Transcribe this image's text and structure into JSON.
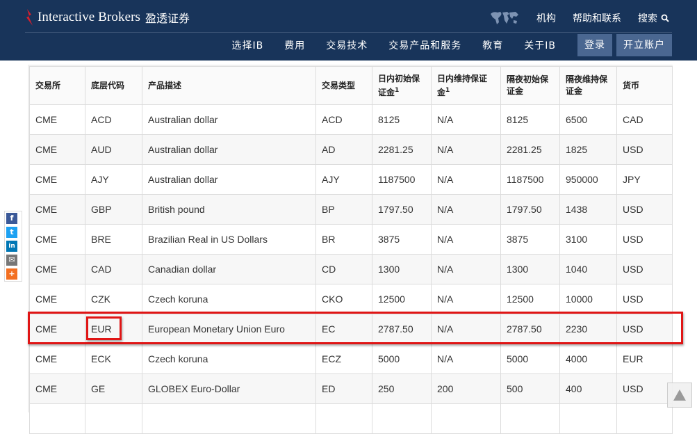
{
  "header": {
    "logo_en": "Interactive Brokers",
    "logo_cn": "盈透证券",
    "util": {
      "institutions": "机构",
      "help": "帮助和联系",
      "search": "搜索"
    },
    "nav": [
      "选择IB",
      "费用",
      "交易技术",
      "交易产品和服务",
      "教育",
      "关于IB"
    ],
    "login": "登录",
    "open_account": "开立账户"
  },
  "table": {
    "headers": [
      {
        "text": "交易所",
        "sup": ""
      },
      {
        "text": "底层代码",
        "sup": ""
      },
      {
        "text": "产品描述",
        "sup": ""
      },
      {
        "text": "交易类型",
        "sup": ""
      },
      {
        "text": "日内初始保证金",
        "sup": "1"
      },
      {
        "text": "日内维持保证金",
        "sup": "1"
      },
      {
        "text": "隔夜初始保证金",
        "sup": ""
      },
      {
        "text": "隔夜维持保证金",
        "sup": ""
      },
      {
        "text": "货币",
        "sup": ""
      }
    ],
    "rows": [
      [
        "CME",
        "ACD",
        "Australian dollar",
        "ACD",
        "8125",
        "N/A",
        "8125",
        "6500",
        "CAD"
      ],
      [
        "CME",
        "AUD",
        "Australian dollar",
        "AD",
        "2281.25",
        "N/A",
        "2281.25",
        "1825",
        "USD"
      ],
      [
        "CME",
        "AJY",
        "Australian dollar",
        "AJY",
        "1187500",
        "N/A",
        "1187500",
        "950000",
        "JPY"
      ],
      [
        "CME",
        "GBP",
        "British pound",
        "BP",
        "1797.50",
        "N/A",
        "1797.50",
        "1438",
        "USD"
      ],
      [
        "CME",
        "BRE",
        "Brazilian Real in US Dollars",
        "BR",
        "3875",
        "N/A",
        "3875",
        "3100",
        "USD"
      ],
      [
        "CME",
        "CAD",
        "Canadian dollar",
        "CD",
        "1300",
        "N/A",
        "1300",
        "1040",
        "USD"
      ],
      [
        "CME",
        "CZK",
        "Czech koruna",
        "CKO",
        "12500",
        "N/A",
        "12500",
        "10000",
        "USD"
      ],
      [
        "CME",
        "EUR",
        "European Monetary Union Euro",
        "EC",
        "2787.50",
        "N/A",
        "2787.50",
        "2230",
        "USD"
      ],
      [
        "CME",
        "ECK",
        "Czech koruna",
        "ECZ",
        "5000",
        "N/A",
        "5000",
        "4000",
        "EUR"
      ],
      [
        "CME",
        "GE",
        "GLOBEX Euro-Dollar",
        "ED",
        "250",
        "200",
        "500",
        "400",
        "USD"
      ],
      [
        "",
        "",
        "",
        "",
        "",
        "",
        "",
        "",
        ""
      ]
    ]
  },
  "share": {
    "facebook": "f",
    "twitter": "t",
    "linkedin": "in",
    "email": "✉",
    "more": "+"
  },
  "back_to_top_icon": "up-triangle-icon",
  "colors": {
    "header_bg": "#18345a",
    "highlight": "#e01515",
    "button_bg": "#4a6791"
  }
}
